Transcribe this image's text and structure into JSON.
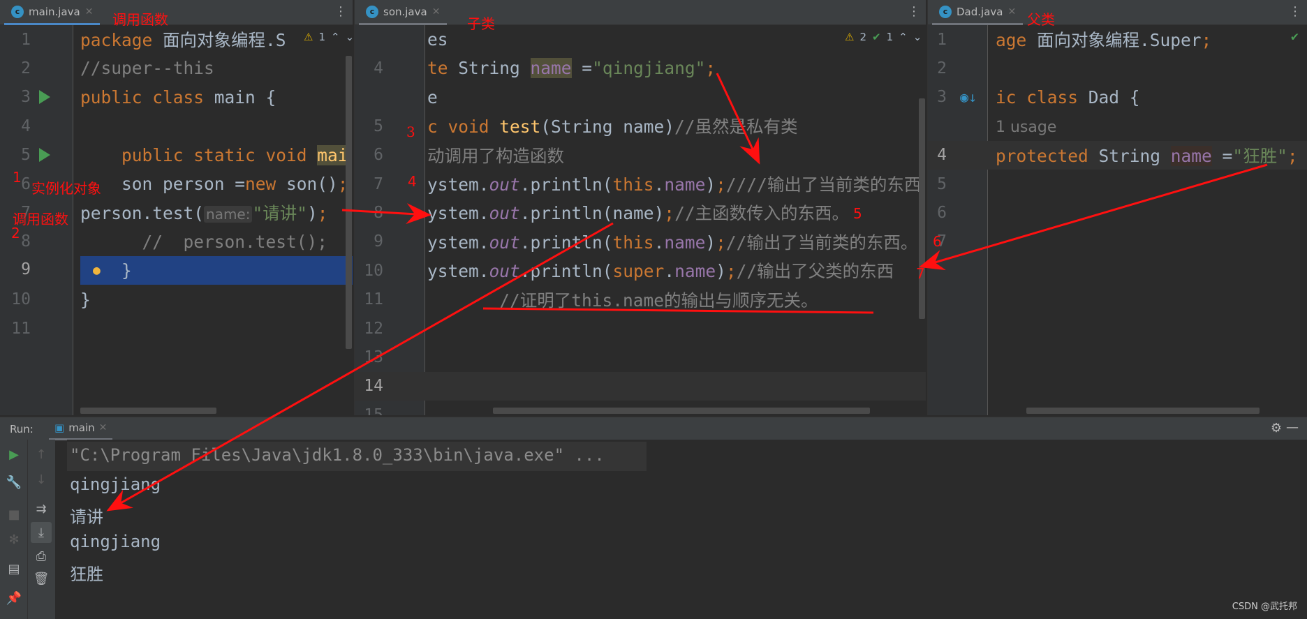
{
  "colors": {
    "keyword": "#cc7832",
    "string": "#6a8759",
    "comment": "#808080",
    "field": "#9876aa",
    "function": "#ffc66d",
    "text": "#a9b7c6",
    "background": "#2b2b2b",
    "selection": "#214283",
    "annotation": "#ff1010"
  },
  "panes": {
    "main": {
      "tab": "main.java",
      "icon": "class-icon",
      "inspections": {
        "warnings": "1"
      },
      "rows": [
        {
          "num": "1",
          "tokens": [
            [
              "k",
              "package"
            ],
            [
              "p",
              " 面向对象编程.S"
            ]
          ]
        },
        {
          "num": "2",
          "tokens": [
            [
              "c",
              "//super--this"
            ]
          ]
        },
        {
          "num": "3",
          "run": true,
          "tokens": [
            [
              "k",
              "public class "
            ],
            [
              "p",
              "main {"
            ]
          ]
        },
        {
          "num": "4",
          "tokens": []
        },
        {
          "num": "5",
          "run": true,
          "tokens": [
            [
              "p",
              "    "
            ],
            [
              "k",
              "public static void "
            ],
            [
              "fn fhl",
              "mai"
            ]
          ]
        },
        {
          "num": "6",
          "tokens": [
            [
              "p",
              "    son person ="
            ],
            [
              "k",
              "new"
            ],
            [
              "p",
              " son()"
            ],
            [
              "k",
              ";"
            ]
          ]
        },
        {
          "num": "7",
          "tokens": [
            [
              "p",
              "person.test("
            ],
            [
              "hint",
              "name:"
            ],
            [
              "s",
              "\"请讲\""
            ],
            [
              "p",
              ")"
            ],
            [
              "k",
              ";"
            ]
          ]
        },
        {
          "num": "8",
          "tokens": [
            [
              "c",
              "      //  person.test();"
            ]
          ]
        },
        {
          "num": "9",
          "current": true,
          "tokens": [
            [
              "p",
              "    }"
            ]
          ]
        },
        {
          "num": "10",
          "tokens": [
            [
              "p",
              "}"
            ]
          ]
        },
        {
          "num": "11",
          "tokens": []
        }
      ]
    },
    "son": {
      "tab": "son.java",
      "icon": "class-icon",
      "inspections": {
        "warnings": "2",
        "weak": "1"
      },
      "rows": [
        {
          "num": "",
          "tokens": [
            [
              "p",
              "es"
            ]
          ]
        },
        {
          "num": "4",
          "tokens": [
            [
              "k",
              "te "
            ],
            [
              "p",
              "String "
            ],
            [
              "f fhl",
              "name"
            ],
            [
              "p",
              " ="
            ],
            [
              "s",
              "\"qingjiang\""
            ],
            [
              "k",
              ";"
            ]
          ]
        },
        {
          "num": "",
          "tokens": [
            [
              "p",
              "e"
            ]
          ]
        },
        {
          "num": "5",
          "tokens": [
            [
              "k",
              "c void "
            ],
            [
              "fn",
              "test"
            ],
            [
              "p",
              "(String name)"
            ],
            [
              "c",
              "//虽然是私有类"
            ]
          ]
        },
        {
          "num": "6",
          "tokens": [
            [
              "c",
              "动调用了构造函数"
            ]
          ]
        },
        {
          "num": "7",
          "tokens": [
            [
              "p",
              "ystem."
            ],
            [
              "it",
              "out"
            ],
            [
              "p",
              ".println("
            ],
            [
              "k",
              "this"
            ],
            [
              "p",
              "."
            ],
            [
              "f",
              "name"
            ],
            [
              "p",
              ")"
            ],
            [
              "k",
              ";"
            ],
            [
              "c",
              "////输出了当前类的东西"
            ]
          ]
        },
        {
          "num": "8",
          "tokens": [
            [
              "p",
              "ystem."
            ],
            [
              "it",
              "out"
            ],
            [
              "p",
              ".println(name)"
            ],
            [
              "k",
              ";"
            ],
            [
              "c",
              "//主函数传入的东西。"
            ]
          ]
        },
        {
          "num": "9",
          "tokens": [
            [
              "p",
              "ystem."
            ],
            [
              "it",
              "out"
            ],
            [
              "p",
              ".println("
            ],
            [
              "k",
              "this"
            ],
            [
              "p",
              "."
            ],
            [
              "f",
              "name"
            ],
            [
              "p",
              ")"
            ],
            [
              "k",
              ";"
            ],
            [
              "c",
              "//输出了当前类的东西。"
            ]
          ]
        },
        {
          "num": "10",
          "tokens": [
            [
              "p",
              "ystem."
            ],
            [
              "it",
              "out"
            ],
            [
              "p",
              ".println("
            ],
            [
              "k",
              "super"
            ],
            [
              "p",
              "."
            ],
            [
              "f",
              "name"
            ],
            [
              "p",
              ")"
            ],
            [
              "k",
              ";"
            ],
            [
              "c",
              "//输出了父类的东西"
            ]
          ]
        },
        {
          "num": "11",
          "tokens": [
            [
              "c",
              "       //证明了this.name的输出与顺序无关。"
            ]
          ]
        },
        {
          "num": "12",
          "tokens": []
        },
        {
          "num": "13",
          "tokens": []
        },
        {
          "num": "14",
          "current": true,
          "tokens": []
        },
        {
          "num": "15",
          "tokens": []
        }
      ]
    },
    "dad": {
      "tab": "Dad.java",
      "icon": "class-icon",
      "inspections": {
        "status": "ok"
      },
      "rows": [
        {
          "num": "1",
          "tokens": [
            [
              "k",
              "age"
            ],
            [
              "p",
              " 面向对象编程.Super"
            ],
            [
              "k",
              ";"
            ]
          ]
        },
        {
          "num": "2",
          "tokens": []
        },
        {
          "num": "3",
          "implemented": true,
          "tokens": [
            [
              "k",
              "ic class "
            ],
            [
              "p",
              "Dad {"
            ]
          ]
        },
        {
          "num": "",
          "tokens": [
            [
              "usage",
              "1 usage"
            ]
          ]
        },
        {
          "num": "4",
          "current": true,
          "tokens": [
            [
              "k",
              "protected "
            ],
            [
              "p",
              "String "
            ],
            [
              "f fhl2",
              "name"
            ],
            [
              "p",
              " ="
            ],
            [
              "s",
              "\"狂胜\""
            ],
            [
              "k",
              ";"
            ]
          ]
        },
        {
          "num": "5",
          "tokens": []
        },
        {
          "num": "6",
          "tokens": []
        },
        {
          "num": "7",
          "tokens": []
        }
      ]
    }
  },
  "run": {
    "label": "Run:",
    "tab": "main",
    "output": [
      "\"C:\\Program Files\\Java\\jdk1.8.0_333\\bin\\java.exe\" ...",
      "qingjiang",
      "请讲",
      "qingjiang",
      "狂胜"
    ]
  },
  "annotations": {
    "main_title": "调用函数",
    "son_title": "子类",
    "dad_title": "父类",
    "step1": "1",
    "step1_label": "实例化对象",
    "step2_label": "调用函数",
    "step2": "2",
    "step3": "3",
    "step4": "4",
    "step5": "5",
    "step6": "6",
    "step7": "7"
  },
  "watermark": "CSDN @武托邦"
}
